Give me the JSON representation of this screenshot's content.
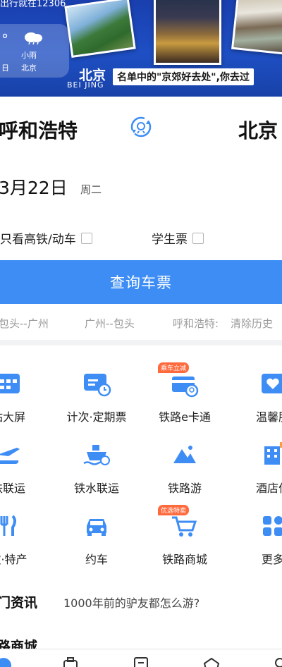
{
  "banner": {
    "top_text": "出行就在12306",
    "weather": {
      "temp": "°",
      "left_label": "日",
      "condition": "小雨",
      "city": "北京"
    },
    "city_title": "北京",
    "city_sub": "BEI JING",
    "caption": "名单中的\"京郊好去处\",你去过"
  },
  "search": {
    "from_city": "呼和浩特",
    "to_city": "北京",
    "date": "3月22日",
    "weekday": "周二",
    "option_highspeed": "只看高铁/动车",
    "option_student": "学生票",
    "query_button": "查询车票",
    "history": [
      "包头--广州",
      "广州--包头",
      "呼和浩特:",
      "清除历史"
    ]
  },
  "services": {
    "row1": [
      "站大屏",
      "计次·定期票",
      "铁路e卡通",
      "温馨服"
    ],
    "row2": [
      "铁联运",
      "铁水联运",
      "铁路游",
      "酒店住"
    ],
    "row3": [
      "饮·特产",
      "约车",
      "铁路商城",
      "更多"
    ],
    "tag_ecard": "乘车立减",
    "tag_mall": "优选特卖"
  },
  "news": {
    "title": "门资讯",
    "headline": "1000年前的驴友都怎么游?"
  },
  "section2": {
    "title": "路商城"
  },
  "colors": {
    "primary": "#3d8df5",
    "banner": "#1e4fc4",
    "tag": "#ff6a3d"
  }
}
